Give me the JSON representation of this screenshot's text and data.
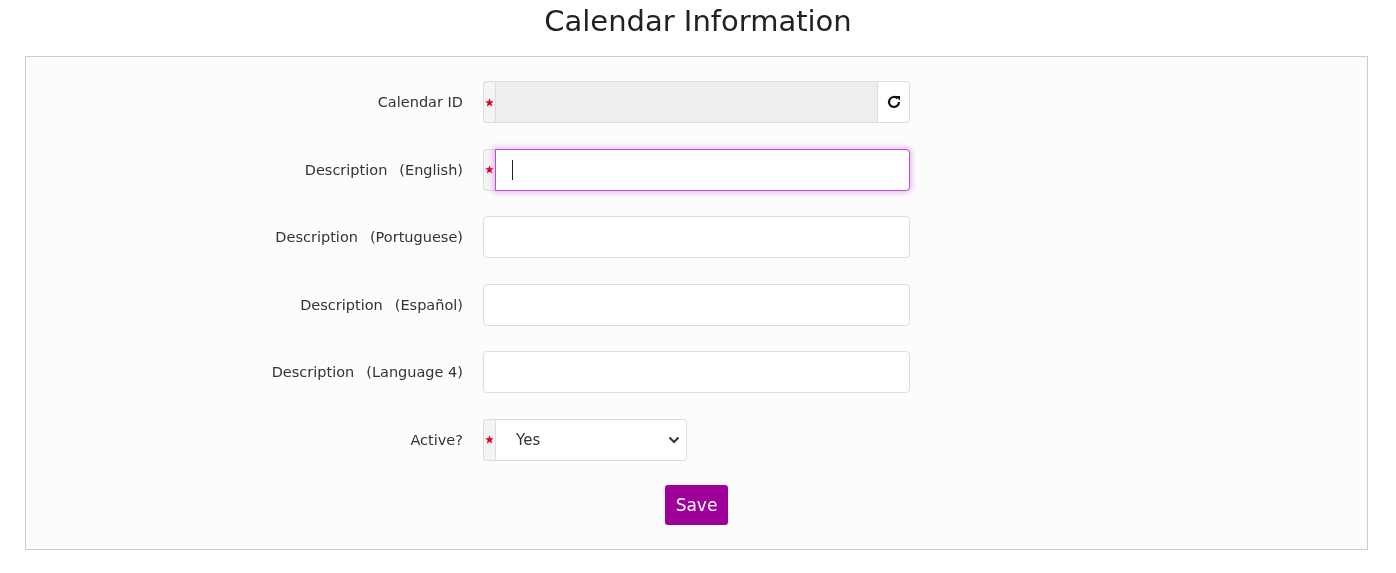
{
  "title": "Calendar Information",
  "fields": [
    {
      "kind": "text",
      "label": "Calendar ID",
      "required": true,
      "disabled": true,
      "focused": false,
      "refresh_button": true
    },
    {
      "kind": "text",
      "label": "Description",
      "qualifier": "(English)",
      "required": true,
      "disabled": false,
      "focused": true,
      "refresh_button": false
    },
    {
      "kind": "text",
      "label": "Description",
      "qualifier": "(Portuguese)",
      "required": false,
      "disabled": false,
      "focused": false,
      "refresh_button": false
    },
    {
      "kind": "text",
      "label": "Description",
      "qualifier": "(Español)",
      "required": false,
      "disabled": false,
      "focused": false,
      "refresh_button": false
    },
    {
      "kind": "text",
      "label": "Description",
      "qualifier": "(Language 4)",
      "required": false,
      "disabled": false,
      "focused": false,
      "refresh_button": false
    },
    {
      "kind": "select",
      "label": "Active?",
      "required": true,
      "value": "Yes"
    }
  ],
  "save_button": "Save"
}
